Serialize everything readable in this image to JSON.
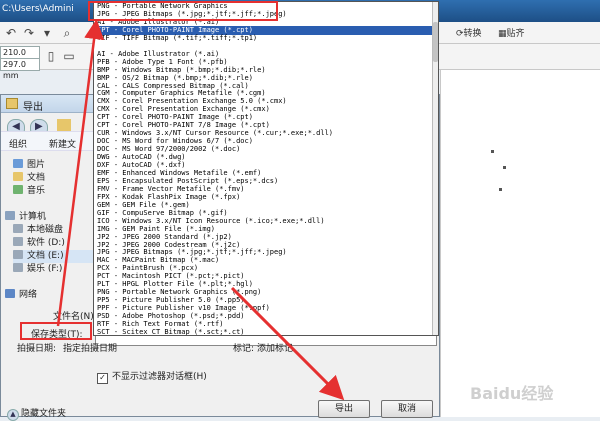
{
  "app": {
    "path_title": "C:\\Users\\Admini",
    "toolbar_right": [
      "转换",
      "贴齐"
    ],
    "width_value": "210.0 mm",
    "height_value": "297.0 mm"
  },
  "dialog": {
    "title": "导出",
    "organize_label": "组织",
    "new_folder_label": "新建文",
    "sidebar": [
      {
        "label": "图片",
        "color": "#6a9bd8"
      },
      {
        "label": "文档",
        "color": "#e7c66a"
      },
      {
        "label": "音乐",
        "color": "#6fb36f"
      },
      {
        "label": "计算机",
        "color": "#8aa2bf"
      },
      {
        "label": "本地磁盘",
        "color": "#9aa8b8"
      },
      {
        "label": "软件 (D:)",
        "color": "#9aa8b8"
      },
      {
        "label": "文档 (E:)",
        "color": "#9aa8b8"
      },
      {
        "label": "娱乐 (F:)",
        "color": "#9aa8b8"
      },
      {
        "label": "网络",
        "color": "#5d87c6"
      }
    ],
    "filename_label": "文件名(N):",
    "filetype_label": "保存类型(T):",
    "date_label": "拍摄日期:",
    "date_value": "指定拍摄日期",
    "tag_label": "标记:",
    "tag_value": "添加标记",
    "checkbox_label": "不显示过滤器对话框(H)",
    "hide_folders_label": "隐藏文件夹",
    "export_button": "导出",
    "cancel_button": "取消"
  },
  "dropdown": {
    "items": [
      "PNG - Portable Network Graphics",
      "JPG - JPEG Bitmaps (*.jpg;*.jtf;*.jff;*.jpeg)",
      "AI - Adobe Illustrator (*.ai)",
      "CPT - Corel PHOTO-PAINT Image (*.cpt)",
      "TIF - TIFF Bitmap (*.tif;*.tiff;*.tp1)",
      "",
      "AI - Adobe Illustrator (*.ai)",
      "PFB - Adobe Type 1 Font (*.pfb)",
      "BMP - Windows Bitmap (*.bmp;*.dib;*.rle)",
      "BMP - OS/2 Bitmap (*.bmp;*.dib;*.rle)",
      "CAL - CALS Compressed Bitmap (*.cal)",
      "CGM - Computer Graphics Metafile (*.cgm)",
      "CMX - Corel Presentation Exchange 5.0 (*.cmx)",
      "CMX - Corel Presentation Exchange (*.cmx)",
      "CPT - Corel PHOTO-PAINT Image (*.cpt)",
      "CPT - Corel PHOTO-PAINT 7/8 Image (*.cpt)",
      "CUR - Windows 3.x/NT Cursor Resource (*.cur;*.exe;*.dll)",
      "DOC - MS Word for Windows 6/7 (*.doc)",
      "DOC - MS Word 97/2000/2002 (*.doc)",
      "DWG - AutoCAD (*.dwg)",
      "DXF - AutoCAD (*.dxf)",
      "EMF - Enhanced Windows Metafile (*.emf)",
      "EPS - Encapsulated PostScript (*.eps;*.dcs)",
      "FMV - Frame Vector Metafile (*.fmv)",
      "FPX - Kodak FlashPix Image (*.fpx)",
      "GEM - GEM File (*.gem)",
      "GIF - CompuServe Bitmap (*.gif)",
      "ICO - Windows 3.x/NT Icon Resource (*.ico;*.exe;*.dll)",
      "IMG - GEM Paint File (*.img)",
      "JP2 - JPEG 2000 Standard (*.jp2)",
      "JP2 - JPEG 2000 Codestream (*.j2c)",
      "JPG - JPEG Bitmaps (*.jpg;*.jtf;*.jff;*.jpeg)",
      "MAC - MACPaint Bitmap (*.mac)",
      "PCX - PaintBrush (*.pcx)",
      "PCT - Macintosh PICT (*.pct;*.pict)",
      "PLT - HPGL Plotter File (*.plt;*.hgl)",
      "PNG - Portable Network Graphics (*.png)",
      "PP5 - Picture Publisher 5.0 (*.pp5)",
      "PPF - Picture Publisher v10 Image (*.ppf)",
      "PSD - Adobe Photoshop (*.psd;*.pdd)",
      "RTF - Rich Text Format (*.rtf)",
      "SCT - Scitex CT Bitmap (*.sct;*.ct)"
    ],
    "selected_index": 3
  },
  "watermark": "Baidu经验"
}
